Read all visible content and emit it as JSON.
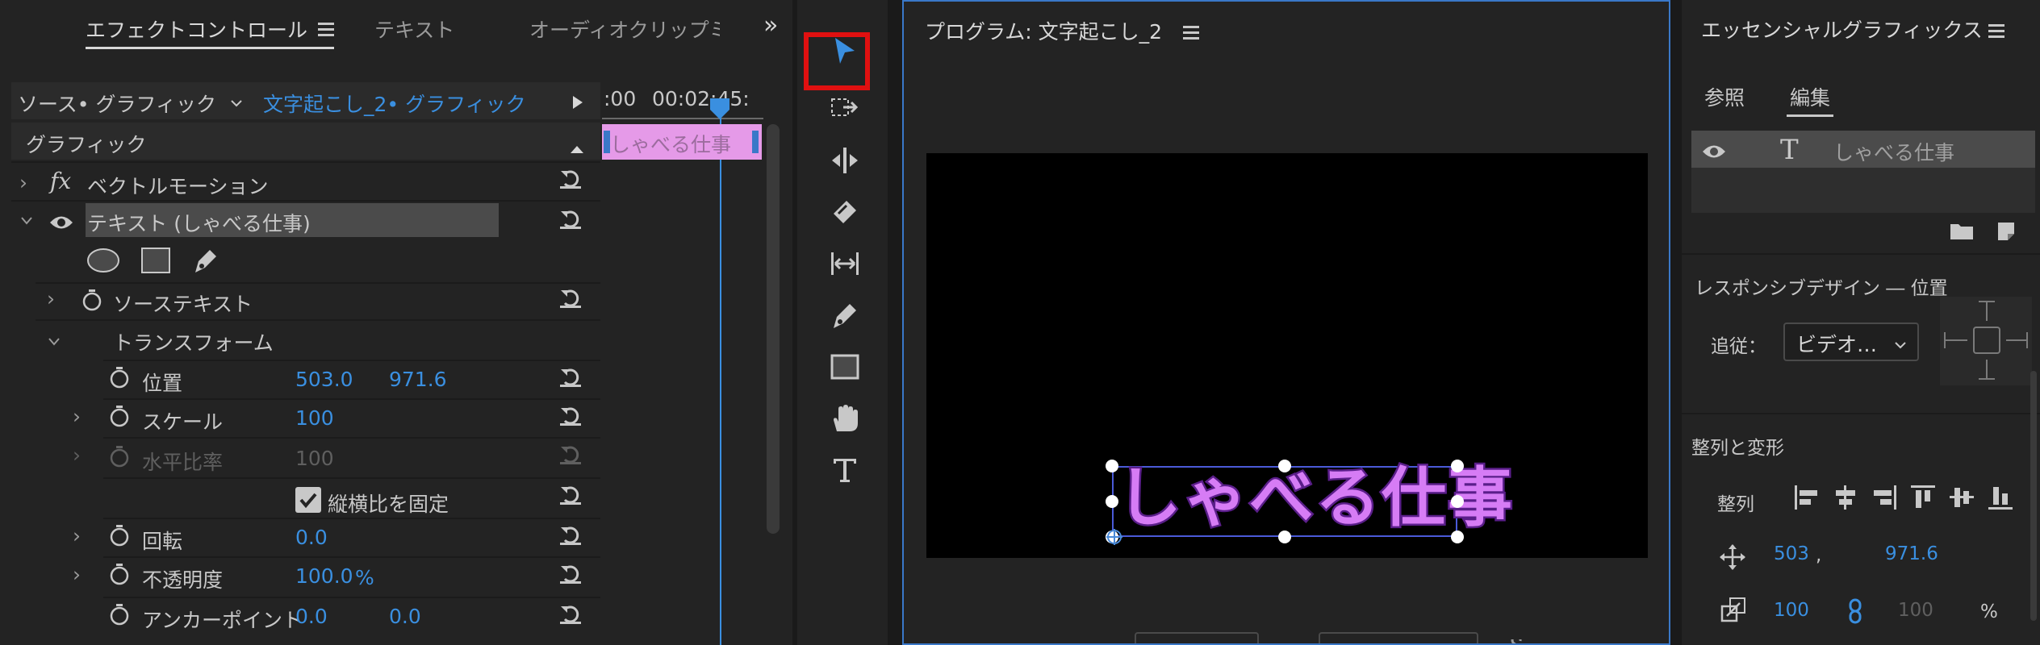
{
  "effect_controls": {
    "tabs": [
      "エフェクトコントロール",
      "テキスト",
      "オーディオクリップミ"
    ],
    "source_label": "ソース• グラフィック",
    "clip_label": "文字起こし_2• グラフィック",
    "timecode_start": ":00",
    "timecode_mid": "00:02:45:",
    "timeline_clip_label": "しゃべる仕事",
    "section_label": "グラフィック",
    "fx_symbol": "fx",
    "vector_motion_label": "ベクトルモーション",
    "text_layer_label": "テキスト (しゃべる仕事)",
    "source_text_label": "ソーステキスト",
    "transform_label": "トランスフォーム",
    "position": {
      "label": "位置",
      "x": "503.0",
      "y": "971.6"
    },
    "scale": {
      "label": "スケール",
      "value": "100"
    },
    "scale_width": {
      "label": "水平比率",
      "value": "100"
    },
    "uniform_scale": {
      "label": "縦横比を固定",
      "checked": true
    },
    "rotation": {
      "label": "回転",
      "value": "0.0"
    },
    "opacity": {
      "label": "不透明度",
      "value": "100.0",
      "unit": "%"
    },
    "anchor": {
      "label": "アンカーポイント",
      "x": "0.0",
      "y": "0.0"
    }
  },
  "tools": [
    "selection-tool",
    "track-select-tool",
    "ripple-edit-tool",
    "razor-tool",
    "slip-tool",
    "pen-tool",
    "rectangle-tool",
    "hand-tool",
    "type-tool"
  ],
  "program": {
    "title": "プログラム: 文字起こし_2",
    "caption_text": "しゃべる仕事"
  },
  "essential_graphics": {
    "title": "エッセンシャルグラフィックス",
    "tabs": [
      "参照",
      "編集"
    ],
    "active_tab": "編集",
    "layer_name": "しゃべる仕事",
    "responsive_label": "レスポンシブデザイン ― 位置",
    "follow_label": "追従：",
    "follow_value": "ビデオ…",
    "align_section": "整列と変形",
    "align_label": "整列",
    "pos_x": "503",
    "pos_sep": ",",
    "pos_y": "971.6",
    "scale_value": "100",
    "scale_width": "100",
    "scale_unit": "%"
  },
  "colors": {
    "accent": "#3a8fe0",
    "clip_pink": "#e59ae8",
    "highlight_red": "#e01010",
    "caption_fill": "#d67cf5"
  }
}
